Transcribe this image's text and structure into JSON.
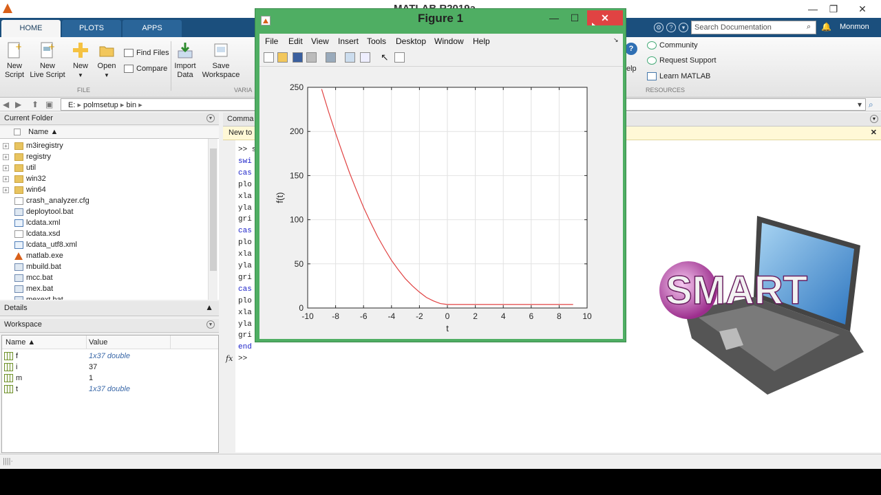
{
  "app": {
    "title": "MATLAB R2019a",
    "user": "Monmon"
  },
  "window_controls": {
    "minimize": "—",
    "maximize": "❐",
    "close": "✕"
  },
  "tabs": [
    {
      "label": "HOME",
      "active": true
    },
    {
      "label": "PLOTS"
    },
    {
      "label": "APPS"
    }
  ],
  "search": {
    "placeholder": "Search Documentation"
  },
  "ribbon": {
    "new_script": "New\nScript",
    "new_live_script": "New\nLive Script",
    "new": "New",
    "open": "Open",
    "find_files": "Find Files",
    "compare": "Compare",
    "import_data": "Import\nData",
    "save_workspace": "Save\nWorkspace",
    "help_partial": "elp",
    "community": "Community",
    "request_support": "Request Support",
    "learn_matlab": "Learn MATLAB",
    "section_file": "FILE",
    "section_variable": "VARIA",
    "section_resources": "RESOURCES"
  },
  "address": {
    "segments": [
      "E:",
      "polmsetup",
      "bin"
    ]
  },
  "current_folder": {
    "title": "Current Folder",
    "column": "Name ▲",
    "items": [
      {
        "name": "m3iregistry",
        "kind": "folder"
      },
      {
        "name": "registry",
        "kind": "folder"
      },
      {
        "name": "util",
        "kind": "folder"
      },
      {
        "name": "win32",
        "kind": "folder"
      },
      {
        "name": "win64",
        "kind": "folder"
      },
      {
        "name": "crash_analyzer.cfg",
        "kind": "file"
      },
      {
        "name": "deploytool.bat",
        "kind": "bat"
      },
      {
        "name": "lcdata.xml",
        "kind": "xml"
      },
      {
        "name": "lcdata.xsd",
        "kind": "file"
      },
      {
        "name": "lcdata_utf8.xml",
        "kind": "xml"
      },
      {
        "name": "matlab.exe",
        "kind": "exe"
      },
      {
        "name": "mbuild.bat",
        "kind": "bat"
      },
      {
        "name": "mcc.bat",
        "kind": "bat"
      },
      {
        "name": "mex.bat",
        "kind": "bat"
      },
      {
        "name": "mexext.bat",
        "kind": "bat"
      }
    ]
  },
  "details": {
    "title": "Details"
  },
  "workspace": {
    "title": "Workspace",
    "col_name": "Name ▲",
    "col_value": "Value",
    "rows": [
      {
        "name": "f",
        "value": "1x37 double",
        "italic": true
      },
      {
        "name": "i",
        "value": "37"
      },
      {
        "name": "m",
        "value": "1"
      },
      {
        "name": "t",
        "value": "1x37 double",
        "italic": true
      }
    ]
  },
  "command_window": {
    "title": "Comma",
    "banner": "New to",
    "lines": [
      {
        "text": ">> s",
        "kw": false
      },
      {
        "text": "swi",
        "kw": true
      },
      {
        "text": "cas",
        "kw": true
      },
      {
        "text": "plo",
        "kw": false
      },
      {
        "text": "xla",
        "kw": false
      },
      {
        "text": "yla",
        "kw": false
      },
      {
        "text": "gri",
        "kw": false
      },
      {
        "text": "cas",
        "kw": true
      },
      {
        "text": "plo",
        "kw": false
      },
      {
        "text": "xla",
        "kw": false
      },
      {
        "text": "yla",
        "kw": false
      },
      {
        "text": "gri",
        "kw": false
      },
      {
        "text": "cas",
        "kw": true
      },
      {
        "text": "plo",
        "kw": false
      },
      {
        "text": "xla",
        "kw": false
      },
      {
        "text": "yla",
        "kw": false
      },
      {
        "text": "gri",
        "kw": false
      },
      {
        "text": "end",
        "kw": true
      }
    ],
    "fx": "fx",
    "prompt": ">>"
  },
  "figure": {
    "title": "Figure 1",
    "menus": [
      "File",
      "Edit",
      "View",
      "Insert",
      "Tools",
      "Desktop",
      "Window",
      "Help"
    ]
  },
  "chart_data": {
    "type": "line",
    "xlabel": "t",
    "ylabel": "f(t)",
    "xlim": [
      -10,
      10
    ],
    "ylim": [
      0,
      250
    ],
    "xticks": [
      -10,
      -8,
      -6,
      -4,
      -2,
      0,
      2,
      4,
      6,
      8,
      10
    ],
    "yticks": [
      0,
      50,
      100,
      150,
      200,
      250
    ],
    "grid": true,
    "color": "#e04040",
    "series": [
      {
        "x": [
          -9,
          -8.5,
          -8,
          -7.5,
          -7,
          -6.5,
          -6,
          -5.5,
          -5,
          -4.5,
          -4,
          -3.5,
          -3,
          -2.5,
          -2,
          -1.5,
          -1,
          -0.5,
          0,
          0.5,
          1,
          1.5,
          2,
          2.5,
          3,
          3.5,
          4,
          4.5,
          5,
          5.5,
          6,
          6.5,
          7,
          7.5,
          8,
          8.5,
          9
        ],
        "y": [
          248,
          222,
          198,
          175,
          153,
          133,
          114,
          97,
          81,
          67,
          54,
          43,
          33,
          25,
          18,
          12,
          8,
          5,
          4,
          4,
          4,
          4,
          4,
          4,
          4,
          4,
          4,
          4,
          4,
          4,
          4,
          4,
          4,
          4,
          4,
          4,
          4
        ]
      }
    ]
  },
  "branding": {
    "logo_text": "SMART"
  },
  "colors": {
    "accent": "#1b4f7d",
    "figure_frame": "#4fae63",
    "close_red": "#e04343"
  }
}
